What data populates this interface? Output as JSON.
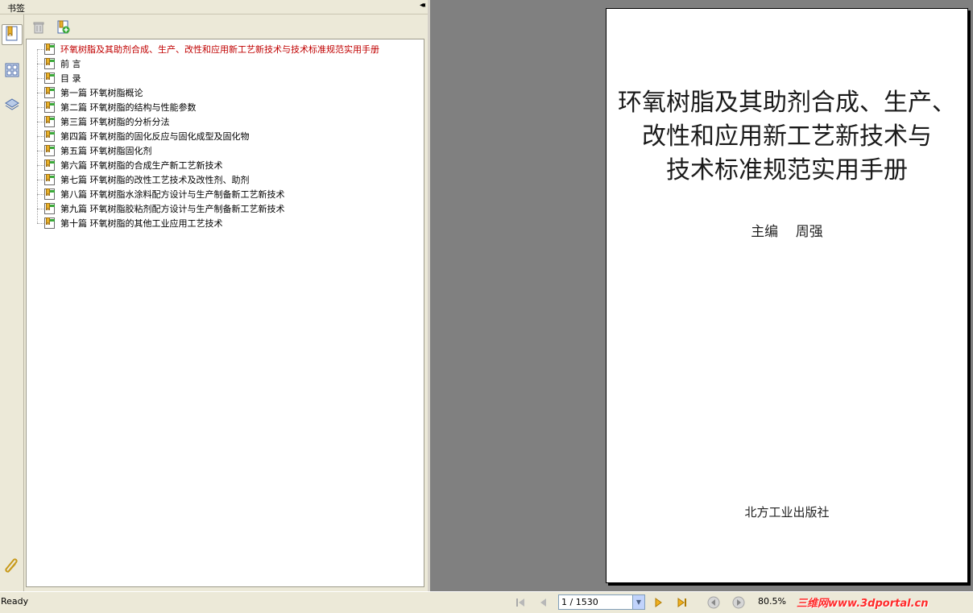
{
  "bookmarks_panel": {
    "title": "书签",
    "collapse_glyph": "◂◂",
    "items": [
      {
        "label": "环氧树脂及其助剂合成、生产、改性和应用新工艺新技术与技术标准规范实用手册",
        "selected": true
      },
      {
        "label": "前 言"
      },
      {
        "label": "目 录"
      },
      {
        "label": "第一篇  环氧树脂概论"
      },
      {
        "label": "第二篇  环氧树脂的结构与性能参数"
      },
      {
        "label": "第三篇  环氧树脂的分析分法"
      },
      {
        "label": "第四篇  环氧树脂的固化反应与固化成型及固化物"
      },
      {
        "label": "第五篇  环氧树脂固化剂"
      },
      {
        "label": "第六篇  环氧树脂的合成生产新工艺新技术"
      },
      {
        "label": "第七篇  环氧树脂的改性工艺技术及改性剂、助剂"
      },
      {
        "label": "第八篇  环氧树脂水涂料配方设计与生产制备新工艺新技术"
      },
      {
        "label": "第九篇  环氧树脂胶粘剂配方设计与生产制备新工艺新技术"
      },
      {
        "label": "第十篇  环氧树脂的其他工业应用工艺技术"
      }
    ]
  },
  "document": {
    "title_lines": [
      "环氧树脂及其助剂合成、生产、",
      "改性和应用新工艺新技术与",
      "技术标准规范实用手册"
    ],
    "editor": "主编    周强",
    "publisher": "北方工业出版社"
  },
  "statusbar": {
    "status": "Ready",
    "page_value": "1 / 1530",
    "zoom": "80.5%",
    "watermark": "三维网www.3dportal.cn"
  },
  "colors": {
    "selected_bookmark": "#c00000",
    "chrome": "#ece9d8",
    "doc_background": "#808080"
  },
  "icons": [
    "bookmarks-icon",
    "thumbnails-icon",
    "layers-icon",
    "attachments-icon",
    "delete-icon",
    "new-bookmark-icon",
    "first-page-icon",
    "previous-page-icon",
    "next-page-icon",
    "last-page-icon",
    "back-icon",
    "forward-icon"
  ]
}
